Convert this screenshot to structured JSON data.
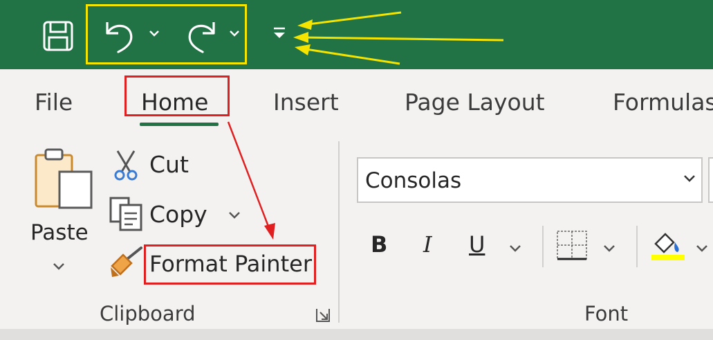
{
  "tabs": [
    "File",
    "Home",
    "Insert",
    "Page Layout",
    "Formulas"
  ],
  "clipboard": {
    "paste_label": "Paste",
    "cut_label": "Cut",
    "copy_label": "Copy",
    "format_painter_label": "Format Painter",
    "group_label": "Clipboard"
  },
  "font": {
    "font_name": "Consolas",
    "bold_label": "B",
    "italic_label": "I",
    "underline_label": "U",
    "group_label": "Font"
  },
  "colors": {
    "titlebar": "#217346",
    "highlight_fill": "#ffff00",
    "annotation_yellow": "#f5e400",
    "annotation_red": "#e02020"
  }
}
